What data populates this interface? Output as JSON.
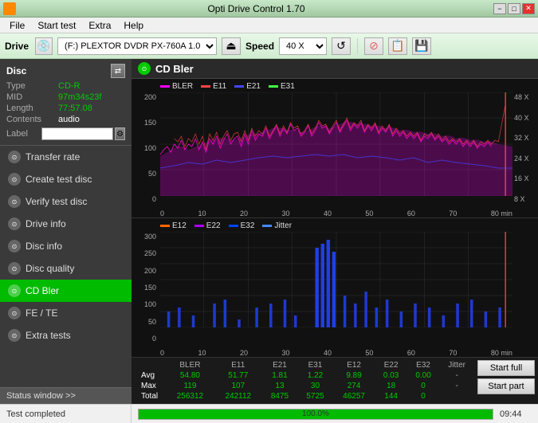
{
  "titlebar": {
    "icon": "⬡",
    "title": "Opti Drive Control 1.70",
    "min": "−",
    "max": "□",
    "close": "✕"
  },
  "menu": {
    "items": [
      "File",
      "Start test",
      "Extra",
      "Help"
    ]
  },
  "toolbar": {
    "drive_label": "Drive",
    "drive_value": "(F:)  PLEXTOR DVDR  PX-760A 1.07",
    "speed_label": "Speed",
    "speed_value": "40 X"
  },
  "disc": {
    "title": "Disc",
    "type_label": "Type",
    "type_value": "CD-R",
    "mid_label": "MID",
    "mid_value": "97m34s23f",
    "length_label": "Length",
    "length_value": "77:57.08",
    "contents_label": "Contents",
    "contents_value": "audio",
    "label_label": "Label",
    "label_value": ""
  },
  "nav": {
    "items": [
      {
        "id": "transfer-rate",
        "label": "Transfer rate",
        "active": false
      },
      {
        "id": "create-test-disc",
        "label": "Create test disc",
        "active": false
      },
      {
        "id": "verify-test-disc",
        "label": "Verify test disc",
        "active": false
      },
      {
        "id": "drive-info",
        "label": "Drive info",
        "active": false
      },
      {
        "id": "disc-info",
        "label": "Disc info",
        "active": false
      },
      {
        "id": "disc-quality",
        "label": "Disc quality",
        "active": false
      },
      {
        "id": "cd-bler",
        "label": "CD Bler",
        "active": true
      },
      {
        "id": "fe-te",
        "label": "FE / TE",
        "active": false
      },
      {
        "id": "extra-tests",
        "label": "Extra tests",
        "active": false
      }
    ]
  },
  "status_window_btn": "Status window >>",
  "chart": {
    "title": "CD Bler",
    "legend1": [
      "BLER",
      "E11",
      "E21",
      "E31"
    ],
    "legend1_colors": [
      "#ff00ff",
      "#ff4444",
      "#4444ff",
      "#44ff44"
    ],
    "legend2": [
      "E12",
      "E22",
      "E32",
      "Jitter"
    ],
    "legend2_colors": [
      "#ff6600",
      "#aa00ff",
      "#0044ff",
      "#4488ff"
    ],
    "y_axis1": [
      "200",
      "150",
      "100",
      "50",
      "0"
    ],
    "y_axis2": [
      "300",
      "250",
      "200",
      "150",
      "100",
      "50",
      "0"
    ],
    "y_axis_right": [
      "48 X",
      "40 X",
      "32 X",
      "24 X",
      "16 X",
      "8 X"
    ],
    "x_axis": [
      "0",
      "10",
      "20",
      "30",
      "40",
      "50",
      "60",
      "70",
      "80 min"
    ]
  },
  "stats": {
    "headers": [
      "",
      "BLER",
      "E11",
      "E21",
      "E31",
      "E12",
      "E22",
      "E32",
      "Jitter"
    ],
    "rows": [
      {
        "label": "Avg",
        "values": [
          "54.80",
          "51.77",
          "1.81",
          "1.22",
          "9.89",
          "0.03",
          "0.00",
          "-"
        ]
      },
      {
        "label": "Max",
        "values": [
          "119",
          "107",
          "13",
          "30",
          "274",
          "18",
          "0",
          "-"
        ]
      },
      {
        "label": "Total",
        "values": [
          "256312",
          "242112",
          "8475",
          "5725",
          "46257",
          "144",
          "0",
          ""
        ]
      }
    ]
  },
  "buttons": {
    "start_full": "Start full",
    "start_part": "Start part"
  },
  "statusbar": {
    "text": "Test completed",
    "progress": 100,
    "progress_text": "100.0%",
    "time": "09:44"
  }
}
